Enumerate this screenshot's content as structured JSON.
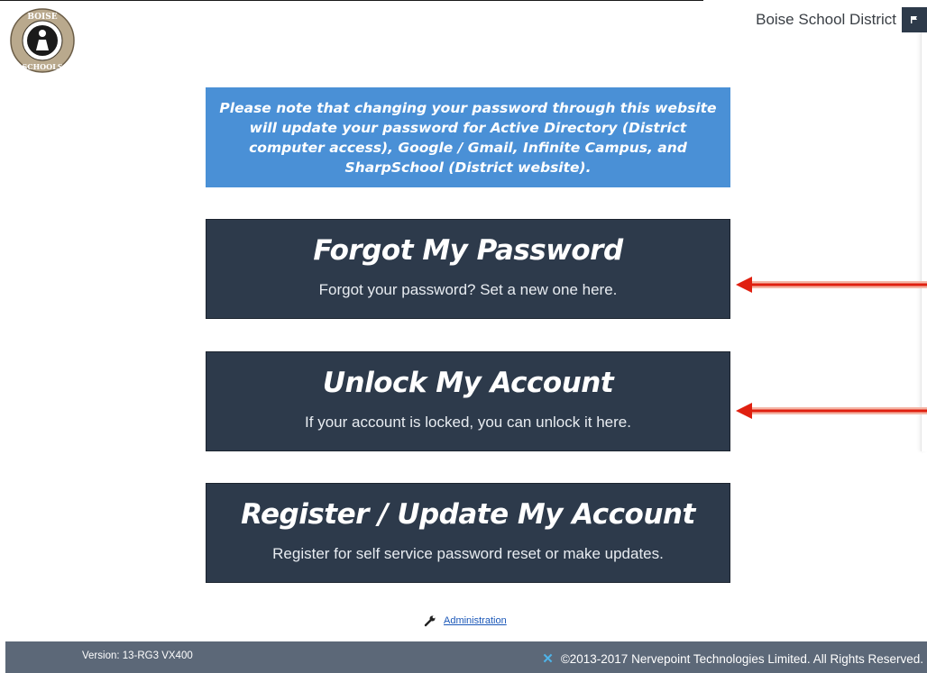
{
  "header": {
    "district_name": "Boise School District",
    "logo_text": "BOISE SCHOOLS"
  },
  "notice": {
    "text": "Please note that changing your password through this website will update your password for Active Directory (District computer access), Google / Gmail, Infinite Campus, and SharpSchool (District website)."
  },
  "cards": [
    {
      "title": "Forgot My Password",
      "subtitle": "Forgot your password? Set a new one here."
    },
    {
      "title": "Unlock My Account",
      "subtitle": "If your account is locked, you can unlock it here."
    },
    {
      "title": "Register / Update My Account",
      "subtitle": "Register for self service password reset or make updates."
    }
  ],
  "admin": {
    "label": "Administration"
  },
  "footer": {
    "version": "Version: 13-RG3 VX400",
    "copyright": "©2013-2017 Nervepoint Technologies Limited. All Rights Reserved."
  },
  "colors": {
    "notice_bg": "#4a90d6",
    "card_bg": "#2d3a4b",
    "arrow": "#e02010",
    "footer_bg": "#5c6878"
  }
}
